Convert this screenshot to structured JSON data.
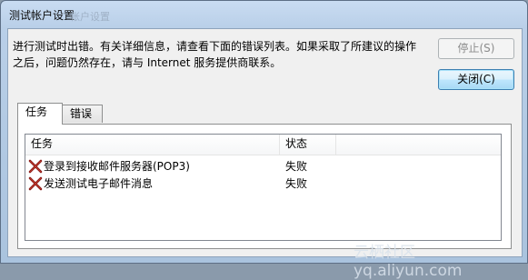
{
  "window": {
    "title": "测试帐户设置",
    "ghost_title": "帐户设置"
  },
  "message": "进行测试时出错。有关详细信息，请查看下面的错误列表。如果采取了所建议的操作之后，问题仍然存在，请与 Internet 服务提供商联系。",
  "buttons": {
    "stop_label": "停止(S)",
    "close_label": "关闭(C)"
  },
  "tabs": [
    {
      "label": "任务",
      "selected": true
    },
    {
      "label": "错误",
      "selected": false
    }
  ],
  "columns": {
    "task": "任务",
    "status": "状态"
  },
  "rows": [
    {
      "task": "登录到接收邮件服务器(POP3)",
      "status": "失败",
      "icon": "error-x-icon"
    },
    {
      "task": "发送测试电子邮件消息",
      "status": "失败",
      "icon": "error-x-icon"
    }
  ],
  "watermark": "云栖社区 yq.aliyun.com"
}
